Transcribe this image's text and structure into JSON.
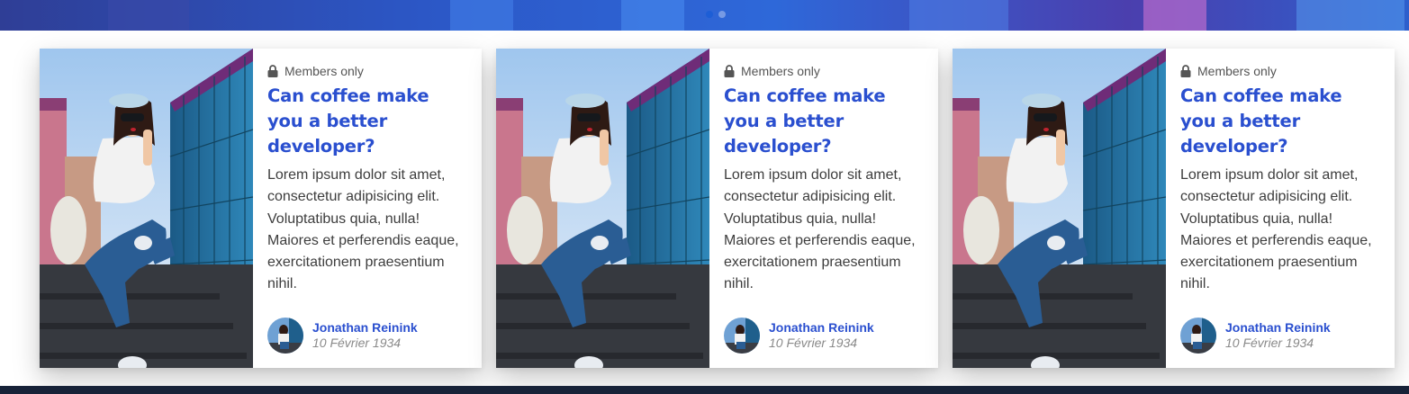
{
  "hero": {
    "slide_count": 2,
    "active_slide": 1
  },
  "cards": [
    {
      "tag": "Members only",
      "title": "Can coffee make you a better developer?",
      "excerpt": "Lorem ipsum dolor sit amet, consectetur adipisicing elit. Voluptatibus quia, nulla! Maiores et perferendis eaque, exercitationem praesentium nihil.",
      "author": {
        "name": "Jonathan Reinink",
        "date": "10 Février 1934"
      }
    },
    {
      "tag": "Members only",
      "title": "Can coffee make you a better developer?",
      "excerpt": "Lorem ipsum dolor sit amet, consectetur adipisicing elit. Voluptatibus quia, nulla! Maiores et perferendis eaque, exercitationem praesentium nihil.",
      "author": {
        "name": "Jonathan Reinink",
        "date": "10 Février 1934"
      }
    },
    {
      "tag": "Members only",
      "title": "Can coffee make you a better developer?",
      "excerpt": "Lorem ipsum dolor sit amet, consectetur adipisicing elit. Voluptatibus quia, nulla! Maiores et perferendis eaque, exercitationem praesentium nihil.",
      "author": {
        "name": "Jonathan Reinink",
        "date": "10 Février 1934"
      }
    }
  ],
  "icons": {
    "tag": "lock-icon"
  },
  "colors": {
    "accent": "#2a4fcf",
    "footer": "#172238",
    "hero": "#2c57c6"
  }
}
